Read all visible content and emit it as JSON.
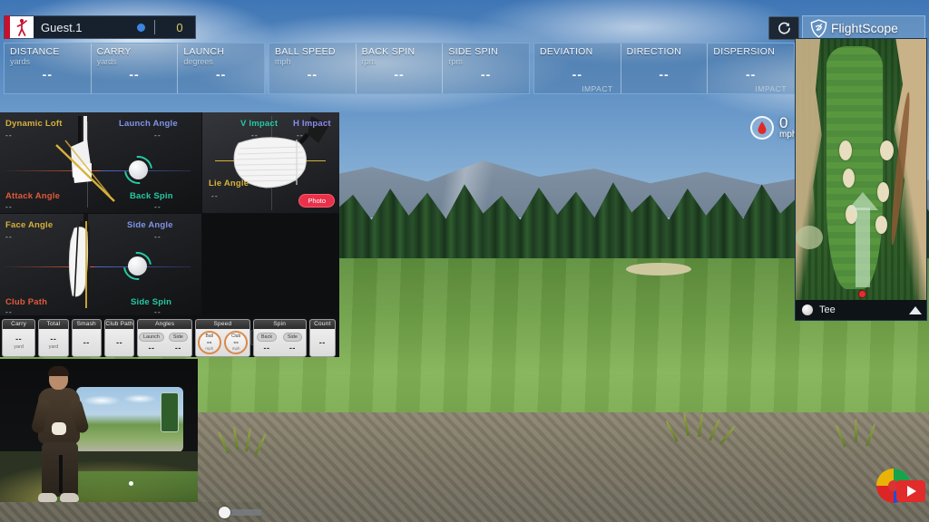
{
  "app": {
    "brand": "FlightScope",
    "brand_icon": "flightscope-logo-icon",
    "refresh_icon": "refresh-icon"
  },
  "player_banner": {
    "logo_icon": "golfer-swing-icon",
    "name": "Guest.1",
    "marker_icon": "blue-dot-icon",
    "score": "0"
  },
  "stat_panels": [
    {
      "name": "distance-panel",
      "cells": [
        {
          "title": "DISTANCE",
          "unit": "yards",
          "value": "--",
          "foot": ""
        },
        {
          "title": "CARRY",
          "unit": "yards",
          "value": "--",
          "foot": ""
        },
        {
          "title": "LAUNCH",
          "unit": "degrees",
          "value": "--",
          "foot": ""
        }
      ]
    },
    {
      "name": "speed-spin-panel",
      "cells": [
        {
          "title": "BALL SPEED",
          "unit": "mph",
          "value": "--",
          "foot": ""
        },
        {
          "title": "BACK SPIN",
          "unit": "rpm",
          "value": "--",
          "foot": ""
        },
        {
          "title": "SIDE SPIN",
          "unit": "rpm",
          "value": "--",
          "foot": ""
        }
      ]
    },
    {
      "name": "deviation-panel",
      "cells": [
        {
          "title": "DEVIATION",
          "unit": "",
          "value": "--",
          "foot": "IMPACT"
        },
        {
          "title": "DIRECTION",
          "unit": "",
          "value": "--",
          "foot": ""
        },
        {
          "title": "DISPERSION",
          "unit": "",
          "value": "--",
          "foot": "IMPACT"
        }
      ]
    }
  ],
  "analysis": {
    "top_left": {
      "name": "swing-face-on-view",
      "labels": [
        {
          "text": "Dynamic Loft",
          "value": "--",
          "color": "#d8b13a"
        },
        {
          "text": "Launch Angle",
          "value": "--",
          "color": "#7f93e8"
        },
        {
          "text": "Attack Angle",
          "value": "--",
          "color": "#e05a3c"
        },
        {
          "text": "Back Spin",
          "value": "--",
          "color": "#24c9a4"
        }
      ]
    },
    "top_right": {
      "name": "impact-location-view",
      "labels": [
        {
          "text": "V Impact",
          "value": "--",
          "color": "#24c9a4"
        },
        {
          "text": "H Impact",
          "value": "--",
          "color": "#8c8cf0"
        },
        {
          "text": "Lie Angle",
          "value": "--",
          "color": "#d8b13a"
        }
      ],
      "photo_button": "Photo"
    },
    "bottom_left": {
      "name": "swing-down-the-line-view",
      "labels": [
        {
          "text": "Face Angle",
          "value": "--",
          "color": "#d8b13a"
        },
        {
          "text": "Side Angle",
          "value": "--",
          "color": "#7f93e8"
        },
        {
          "text": "Club Path",
          "value": "--",
          "color": "#e05a3c"
        },
        {
          "text": "Side Spin",
          "value": "--",
          "color": "#24c9a4"
        }
      ]
    },
    "playback": [
      {
        "name": "play-button",
        "icon": "play-icon"
      },
      {
        "name": "step-back-button",
        "icon": "step-back-icon"
      },
      {
        "name": "step-forward-button",
        "icon": "step-forward-icon"
      }
    ]
  },
  "metrics": [
    {
      "name": "carry-metric",
      "head": "Carry",
      "value": "--",
      "unit": "yard"
    },
    {
      "name": "total-metric",
      "head": "Total",
      "value": "--",
      "unit": "yard"
    },
    {
      "name": "smash-factor-metric",
      "head": "Smash Fac.",
      "value": "--",
      "unit": ""
    },
    {
      "name": "club-path-metric",
      "head": "Club Path",
      "value": "--",
      "unit": ""
    },
    {
      "name": "angles-metric",
      "head": "Angles",
      "subs": [
        {
          "label": "Launch",
          "value": "--"
        },
        {
          "label": "Side",
          "value": "--"
        }
      ]
    },
    {
      "name": "speed-metric",
      "head": "Speed",
      "gauges": [
        {
          "label": "Ball",
          "value": "--",
          "unit": "mph"
        },
        {
          "label": "Club",
          "value": "--",
          "unit": "mph"
        }
      ]
    },
    {
      "name": "spin-metric",
      "head": "Spin",
      "subs": [
        {
          "label": "Back",
          "value": "--"
        },
        {
          "label": "Side",
          "value": "--"
        }
      ]
    },
    {
      "name": "count-metric",
      "head": "Count",
      "value": "--",
      "unit": ""
    }
  ],
  "wind": {
    "icon": "wind-direction-icon",
    "value": "0",
    "unit": "mph"
  },
  "minimap": {
    "name": "hole-overview-map",
    "ball_icon": "golf-ball-icon",
    "label": "Tee",
    "expand_icon": "triangle-up-icon"
  },
  "video": {
    "name": "swing-video-overlay",
    "slider_name": "video-timeline-slider"
  },
  "footer_widgets": {
    "compass_icon": "color-wheel-icon",
    "play_icon": "play-video-icon"
  },
  "colors": {
    "accent_yellow": "#d8b13a",
    "accent_blue": "#7f93e8",
    "accent_red": "#e05a3c",
    "accent_teal": "#24c9a4",
    "photo_red": "#e8314a",
    "gauge_orange": "#d98b4a"
  }
}
